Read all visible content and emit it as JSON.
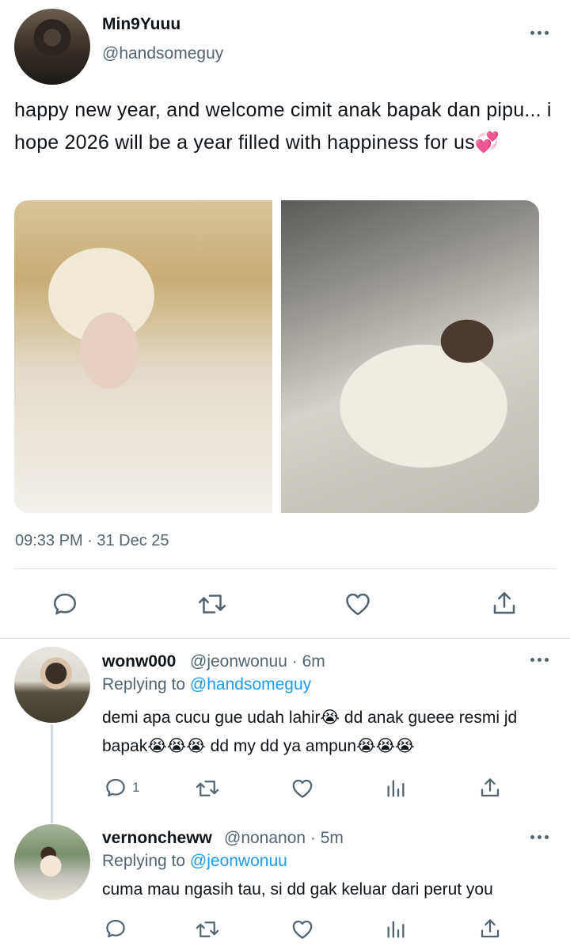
{
  "tweet": {
    "display_name": "Min9Yuuu",
    "handle": "@handsomeguy",
    "text": "happy new year, and welcome cimit anak bapak dan pipu... i hope 2026 will be a year filled with happiness for us💞",
    "timestamp": "09:33 PM · 31 Dec 25"
  },
  "replies": [
    {
      "display_name": "wonw000",
      "handle": "@jeonwonuu",
      "time": "· 6m",
      "replying_label": "Replying to",
      "replying_to": "@handsomeguy",
      "text": "demi apa cucu gue udah lahir😭 dd anak gueee resmi jd bapak😭😭😭  dd my dd ya ampun😭😭😭",
      "reply_count": "1"
    },
    {
      "display_name": "vernoncheww",
      "handle": "@nonanon",
      "time": "· 5m",
      "replying_label": "Replying to",
      "replying_to": "@jeonwonuu",
      "text": "cuma mau ngasih tau, si dd gak keluar dari perut you",
      "reply_count": ""
    }
  ],
  "icons": {
    "reply": "reply-icon",
    "retweet": "retweet-icon",
    "like": "heart-icon",
    "share": "share-icon",
    "views": "views-icon",
    "more": "more-icon"
  },
  "colors": {
    "text": "#0f1419",
    "secondary": "#536471",
    "link": "#1d9bf0",
    "divider": "#e1e6ea"
  }
}
